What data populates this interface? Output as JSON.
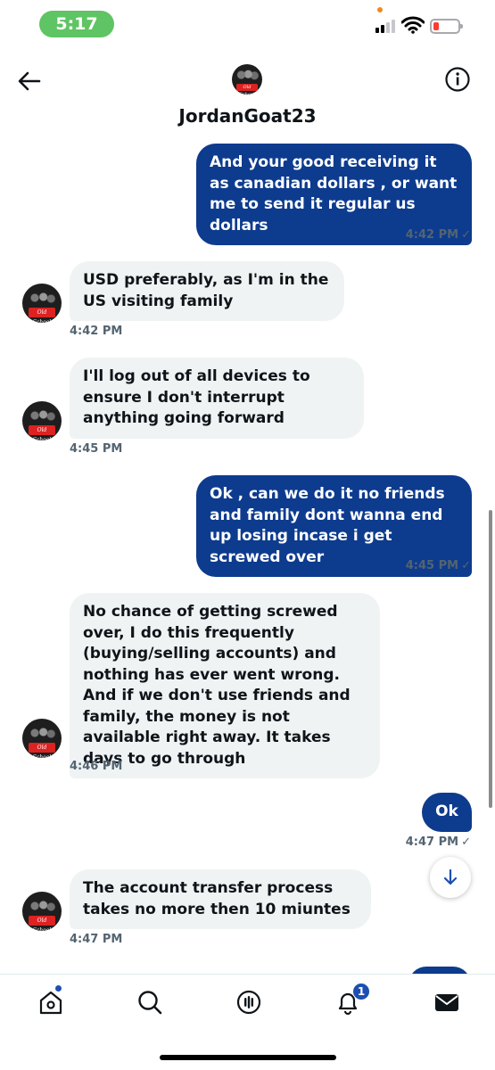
{
  "status_bar": {
    "time": "5:17"
  },
  "header": {
    "name": "JordanGoat23"
  },
  "messages": [
    {
      "text": "And your good receiving it as canadian dollars , or want me to send it regular us dollars",
      "time": "4:42 PM",
      "check": "✓"
    },
    {
      "text": "USD preferably, as I'm in the US visiting family",
      "time": "4:42 PM"
    },
    {
      "text": "I'll log out of all devices to ensure I don't interrupt anything going forward",
      "time": "4:45 PM"
    },
    {
      "text": "Ok , can we do it no friends and family dont wanna end up losing incase i get screwed over",
      "time": "4:45 PM",
      "check": "✓"
    },
    {
      "text": "No chance of getting screwed over, I do this frequently (buying/selling accounts) and nothing has ever went wrong. And if we don't use friends and family, the money is not available right away. It takes days to go through",
      "time": "4:46 PM"
    },
    {
      "text": "Ok",
      "time": "4:47 PM",
      "check": "✓"
    },
    {
      "text": "The account transfer process takes no more then 10 miuntes",
      "time": "4:47 PM"
    }
  ],
  "nav": {
    "notifications_count": "1"
  },
  "avatar_text": "Old School",
  "colors": {
    "outgoing": "#0d3b8e",
    "incoming": "#eff3f4",
    "accent": "#1d4fb2"
  }
}
